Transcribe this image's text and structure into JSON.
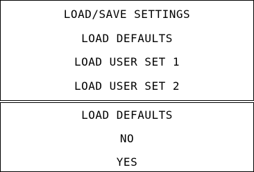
{
  "menu": {
    "title": "LOAD/SAVE SETTINGS",
    "items": [
      "LOAD DEFAULTS",
      "LOAD USER SET 1",
      "LOAD USER SET 2"
    ]
  },
  "confirm": {
    "title": "LOAD DEFAULTS",
    "options": [
      "NO",
      "YES"
    ]
  }
}
